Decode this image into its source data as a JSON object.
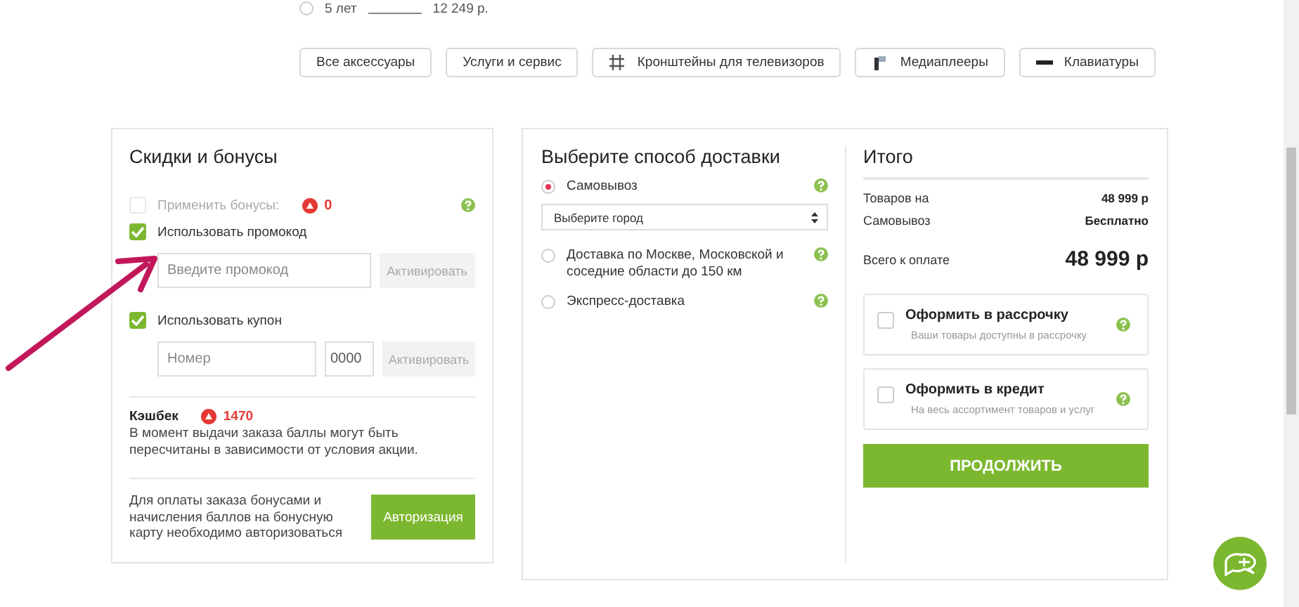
{
  "top_option": {
    "label": "5 лет",
    "price": "12 249  р.",
    "selected": false
  },
  "accessory_links": [
    {
      "label": "Все аксессуары",
      "kind": "plain"
    },
    {
      "label": "Услуги и сервис",
      "kind": "plain"
    },
    {
      "label": "Кронштейны для телевизоров",
      "kind": "bracket"
    },
    {
      "label": "Медиаплееры",
      "kind": "player"
    },
    {
      "label": "Клавиатуры",
      "kind": "keyboard"
    }
  ],
  "discounts": {
    "title": "Скидки и бонусы",
    "bonus": {
      "label": "Применить бонусы:",
      "checked": false,
      "disabled": true,
      "value": "0"
    },
    "promo": {
      "label": "Использовать промокод",
      "checked": true,
      "placeholder": "Введите промокод",
      "button": "Активировать"
    },
    "coupon": {
      "label": "Использовать купон",
      "checked": true,
      "placeholder": "Номер",
      "code_placeholder": "0000",
      "button": "Активировать"
    },
    "cashback": {
      "label": "Кэшбек",
      "value": "1470",
      "note": "В момент выдачи заказа баллы могут быть пересчитаны в зависимости от условия акции."
    },
    "auth": {
      "text": "Для оплаты заказа бонусами и начисления баллов на бонусную карту необходимо авторизоваться",
      "button": "Авторизация"
    }
  },
  "delivery": {
    "title": "Выберите способ доставки",
    "options": [
      {
        "label": "Самовывоз",
        "selected": true,
        "city_placeholder": "Выберите город"
      },
      {
        "label": "Доставка по Москве, Московской и соседние области до 150 км",
        "selected": false
      },
      {
        "label": "Экспресс-доставка",
        "selected": false
      }
    ]
  },
  "total": {
    "title": "Итого",
    "rows": [
      {
        "label": "Товаров на",
        "value": "48 999 р"
      },
      {
        "label": "Самовывоз",
        "value": "Бесплатно"
      }
    ],
    "sum_label": "Всего к оплате",
    "sum_value": "48 999 р",
    "offers": [
      {
        "title": "Оформить в рассрочку",
        "subtitle": "Ваши товары доступны в рассрочку",
        "checked": false
      },
      {
        "title": "Оформить в кредит",
        "subtitle": "На весь ассортимент товаров и услуг",
        "checked": false
      }
    ],
    "button": "ПРОДОЛЖИТЬ"
  }
}
